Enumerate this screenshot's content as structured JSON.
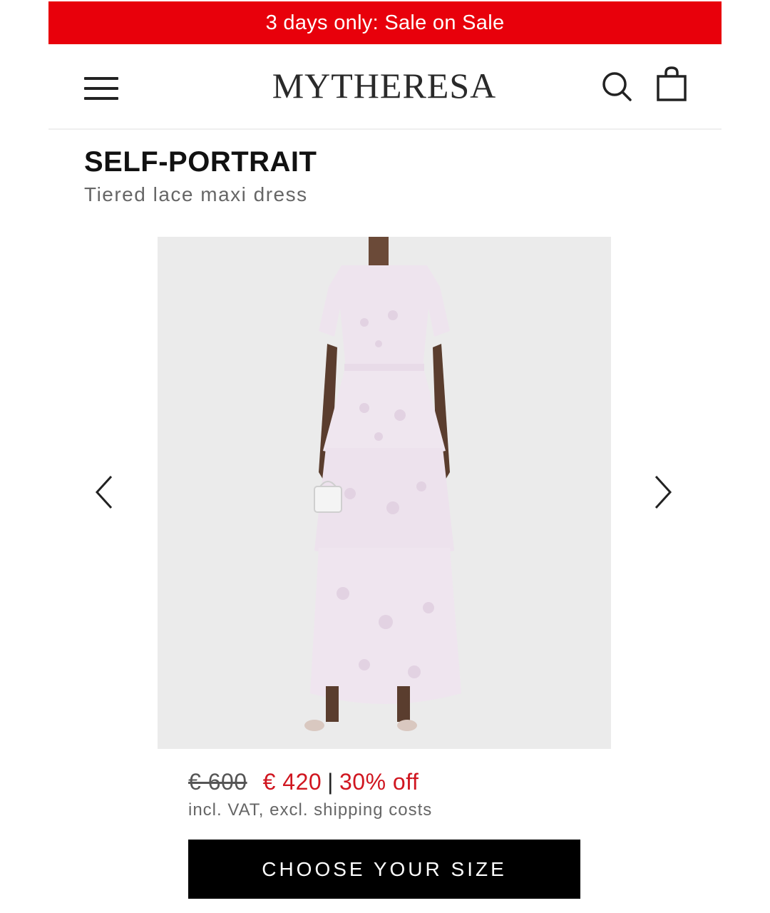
{
  "promo": {
    "text": "3 days only: Sale on Sale",
    "background": "#e8000b"
  },
  "header": {
    "logo": "MYTHERESA",
    "menu_icon": "hamburger-menu-icon",
    "search_icon": "search-icon",
    "bag_icon": "shopping-bag-icon"
  },
  "product": {
    "brand": "SELF-PORTRAIT",
    "name": "Tiered lace maxi dress",
    "image": "lilac-lace-tiered-maxi-dress-photo",
    "gallery_prev_icon": "chevron-left-icon",
    "gallery_next_icon": "chevron-right-icon",
    "price_original": "€ 600",
    "price_sale": "€ 420",
    "separator": "|",
    "discount": "30% off",
    "vat_note": "incl. VAT, excl. shipping costs",
    "sale_color": "#d01620"
  },
  "cta": {
    "label": "CHOOSE YOUR SIZE"
  }
}
